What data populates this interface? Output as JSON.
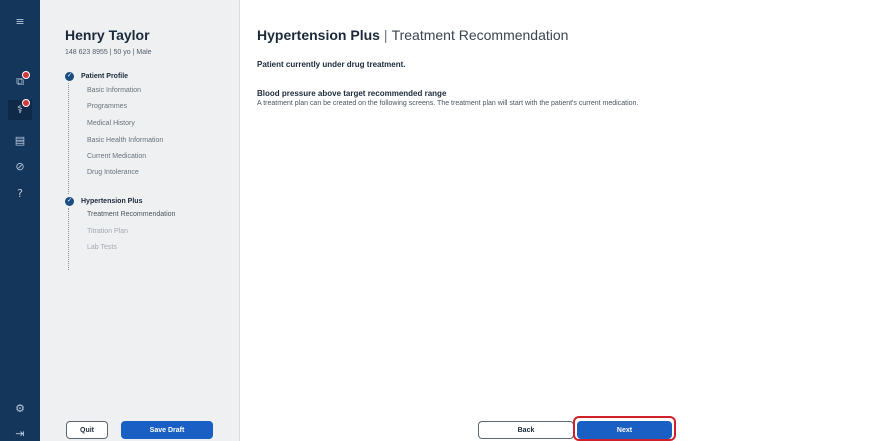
{
  "rail": {
    "items": [
      {
        "icon": "menu-icon",
        "glyph": "≡"
      },
      {
        "icon": "clipboard-icon",
        "glyph": "⧉",
        "badge": true
      },
      {
        "icon": "stethoscope-icon",
        "glyph": "⚕",
        "badge": true,
        "active": true
      },
      {
        "icon": "document-icon",
        "glyph": "▤"
      },
      {
        "icon": "pills-icon",
        "glyph": "⊘"
      },
      {
        "icon": "help-icon",
        "glyph": "?"
      },
      {
        "icon": "settings-icon",
        "glyph": "⚙"
      },
      {
        "icon": "logout-icon",
        "glyph": "⇥"
      }
    ]
  },
  "patient": {
    "name": "Henry Taylor",
    "meta": "148 623 8955 | 50 yo | Male"
  },
  "profile_section": {
    "title": "Patient Profile",
    "items": [
      "Basic Information",
      "Programmes",
      "Medical History",
      "Basic Health Information",
      "Current Medication",
      "Drug Intolerance"
    ]
  },
  "program_section": {
    "title": "Hypertension Plus",
    "items": [
      "Treatment Recommendation",
      "Titration Plan",
      "Lab Tests"
    ]
  },
  "footer_left": {
    "quit_label": "Quit",
    "save_draft_label": "Save Draft"
  },
  "main": {
    "title_bold": "Hypertension Plus",
    "title_sep": "|",
    "title_sub": "Treatment Recommendation",
    "status_line": "Patient currently under drug treatment.",
    "bp_heading": "Blood pressure above target recommended range",
    "bp_text": "A treatment plan can be created on the following screens. The treatment plan will start with the patient's current medication."
  },
  "footer_main": {
    "back_label": "Back",
    "next_label": "Next"
  },
  "colors": {
    "rail": "#14365a",
    "primary": "#1a5fc4",
    "highlight": "#d0202a"
  }
}
